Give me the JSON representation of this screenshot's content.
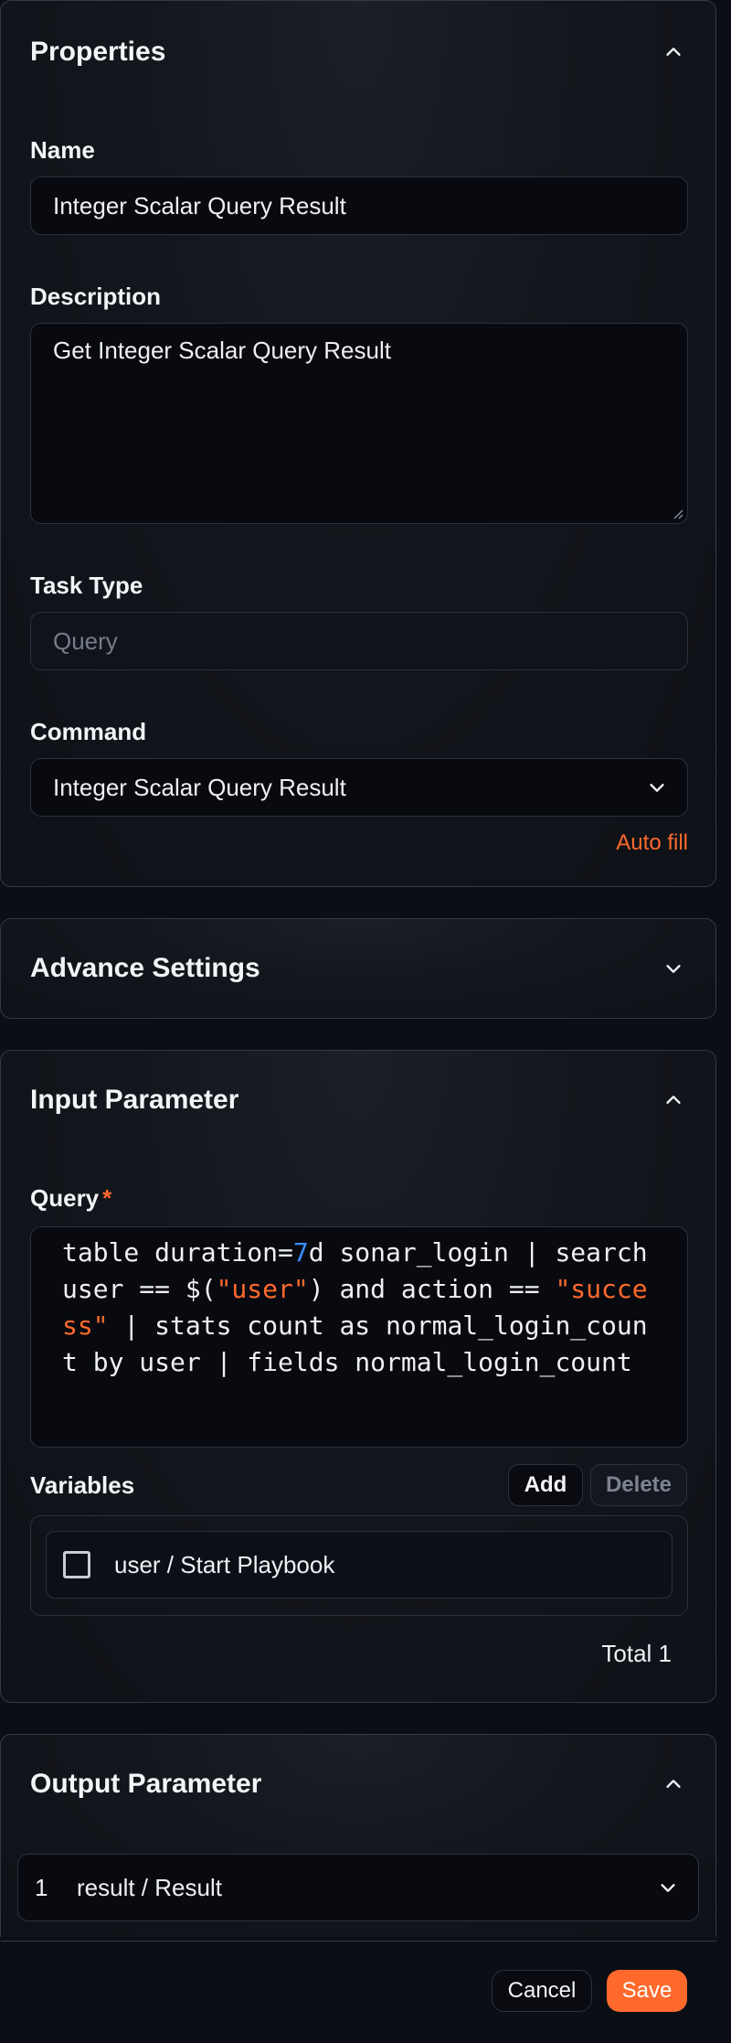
{
  "properties": {
    "title": "Properties",
    "name_label": "Name",
    "name_value": "Integer Scalar Query Result",
    "description_label": "Description",
    "description_value": "Get Integer Scalar Query Result",
    "task_type_label": "Task Type",
    "task_type_placeholder": "Query",
    "command_label": "Command",
    "command_value": "Integer Scalar Query Result",
    "auto_fill_label": "Auto fill"
  },
  "advance_settings": {
    "title": "Advance Settings"
  },
  "input_parameter": {
    "title": "Input Parameter",
    "query_label": "Query",
    "required_mark": "*",
    "query_lines": [
      [
        {
          "t": "table duration="
        },
        {
          "t": "7",
          "k": "num"
        },
        {
          "t": "d sonar_login | search"
        }
      ],
      [
        {
          "t": "user == $("
        },
        {
          "t": "\"user\"",
          "k": "str"
        },
        {
          "t": ") and action == "
        },
        {
          "t": "\"succe",
          "k": "str"
        }
      ],
      [
        {
          "t": "ss\"",
          "k": "str"
        },
        {
          "t": " | stats count as normal_login_coun"
        }
      ],
      [
        {
          "t": "t by user | fields normal_login_count"
        }
      ]
    ],
    "variables_label": "Variables",
    "add_label": "Add",
    "delete_label": "Delete",
    "variables": [
      {
        "label": "user / Start Playbook",
        "checked": false
      }
    ],
    "total_label": "Total 1"
  },
  "output_parameter": {
    "title": "Output Parameter",
    "rows": [
      {
        "index": "1",
        "label": "result / Result"
      }
    ]
  },
  "footer": {
    "cancel_label": "Cancel",
    "save_label": "Save"
  },
  "colors": {
    "accent": "#ff6a2c",
    "number": "#3a8dff",
    "background": "#0b0e14"
  }
}
